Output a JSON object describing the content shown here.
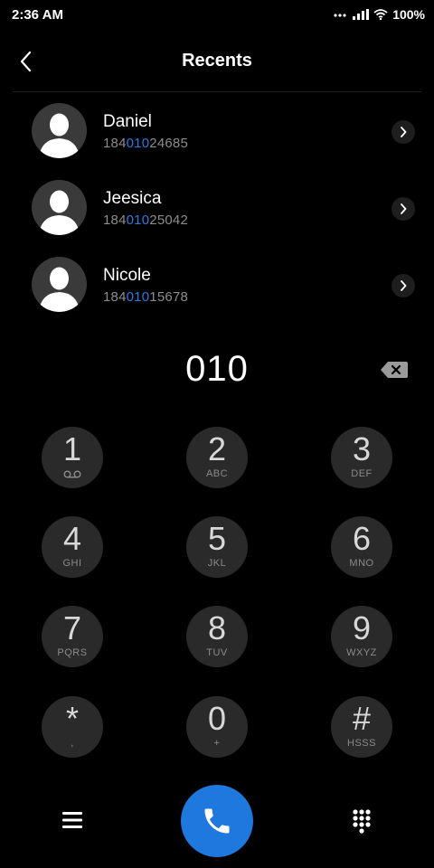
{
  "status_bar": {
    "time": "2:36 AM",
    "battery_percent": "100%"
  },
  "header": {
    "title": "Recents"
  },
  "contacts": [
    {
      "name": "Daniel",
      "number_prefix": "184",
      "number_match": "010",
      "number_suffix": "24685"
    },
    {
      "name": "Jeesica",
      "number_prefix": "184",
      "number_match": "010",
      "number_suffix": "25042"
    },
    {
      "name": "Nicole",
      "number_prefix": "184",
      "number_match": "010",
      "number_suffix": "15678"
    }
  ],
  "dialer": {
    "entered_number": "010"
  },
  "keypad": {
    "keys": [
      {
        "digit": "1",
        "letters": ""
      },
      {
        "digit": "2",
        "letters": "ABC"
      },
      {
        "digit": "3",
        "letters": "DEF"
      },
      {
        "digit": "4",
        "letters": "GHI"
      },
      {
        "digit": "5",
        "letters": "JKL"
      },
      {
        "digit": "6",
        "letters": "MNO"
      },
      {
        "digit": "7",
        "letters": "PQRS"
      },
      {
        "digit": "8",
        "letters": "TUV"
      },
      {
        "digit": "9",
        "letters": "WXYZ"
      },
      {
        "digit": "*",
        "letters": ","
      },
      {
        "digit": "0",
        "letters": "+"
      },
      {
        "digit": "#",
        "letters": "HSSS"
      }
    ]
  },
  "colors": {
    "accent": "#1e78de",
    "match_highlight": "#2a7ae2",
    "key_bg": "#2a2a2a",
    "background": "#000000"
  },
  "icons": {
    "back": "chevron-left-icon",
    "detail": "chevron-right-icon",
    "backspace": "backspace-icon",
    "voicemail": "voicemail-icon",
    "call": "phone-icon",
    "menu": "menu-icon",
    "dialpad": "dialpad-icon"
  }
}
